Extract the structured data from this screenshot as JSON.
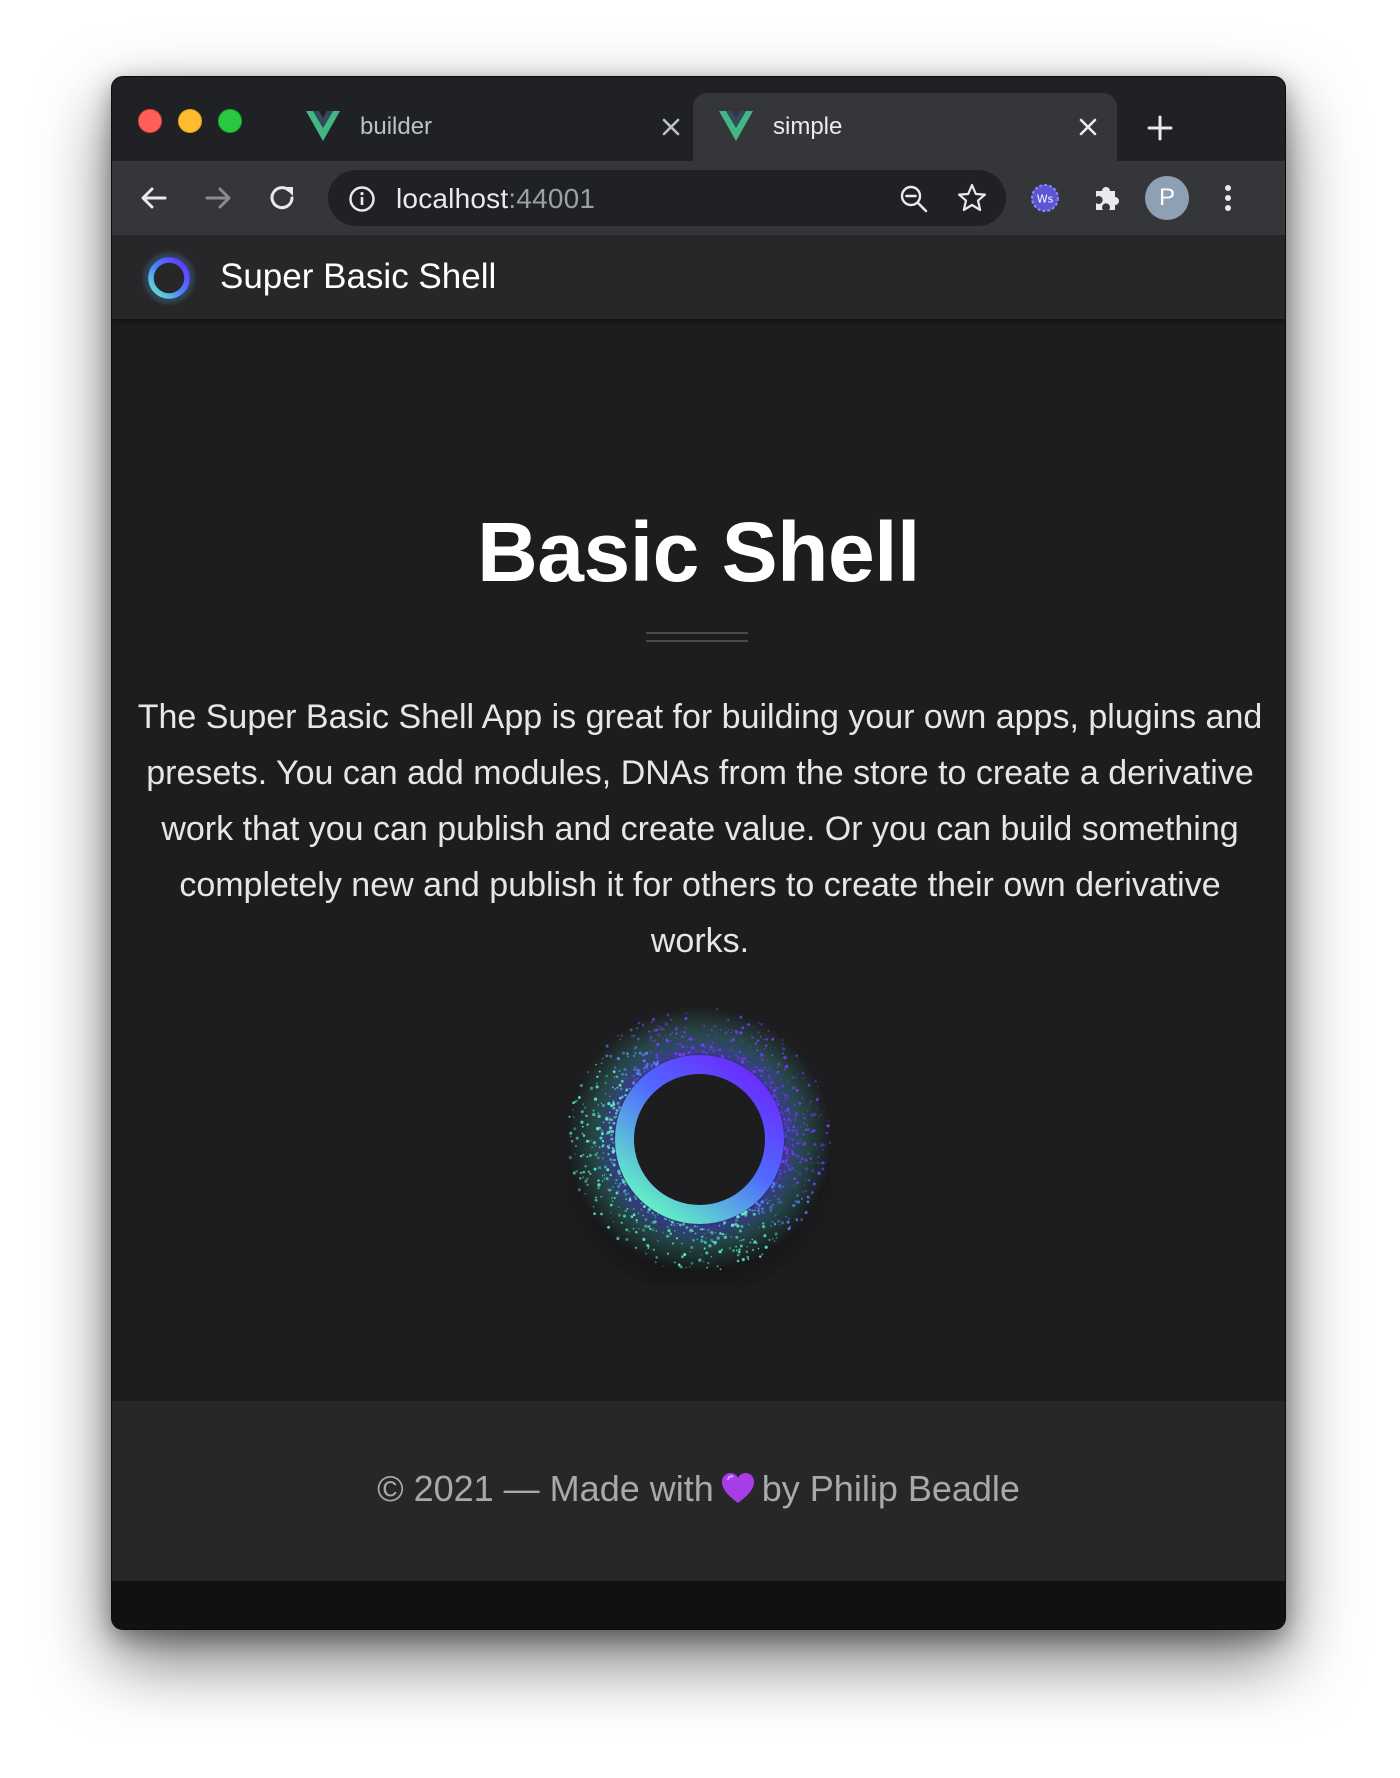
{
  "browser": {
    "tabs": [
      {
        "title": "builder",
        "active": false
      },
      {
        "title": "simple",
        "active": true
      }
    ],
    "url_host": "localhost",
    "url_port": ":44001",
    "profile_initial": "P",
    "extension_badge": "Ws"
  },
  "app": {
    "title": "Super Basic Shell"
  },
  "hero": {
    "title": "Basic Shell",
    "description": "The Super Basic Shell App is great for building your own apps, plugins and presets. You can add modules, DNAs from the store to create a derivative work that you can publish and create value. Or you can build something completely new and publish it for others to create their own derivative works."
  },
  "footer": {
    "prefix": "© 2021 — Made with",
    "suffix": "by Philip Beadle"
  },
  "colors": {
    "accent_purple": "#6a2cff",
    "accent_teal": "#63f2c4",
    "heart": "#a63de8"
  },
  "icons": [
    "vue-logo-icon",
    "close-icon",
    "plus-icon",
    "back-arrow-icon",
    "forward-arrow-icon",
    "reload-icon",
    "info-icon",
    "zoom-icon",
    "star-icon",
    "extensions-puzzle-icon",
    "menu-dots-icon",
    "ring-logo-icon",
    "heart-icon"
  ]
}
